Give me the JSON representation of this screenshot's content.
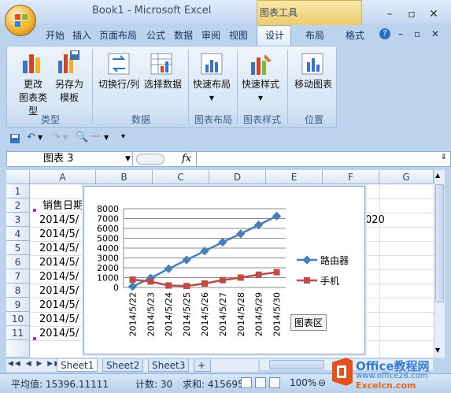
{
  "window": {
    "title": "Book1 - Microsoft Excel",
    "context_tab": "图表工具"
  },
  "tabs": [
    "开始",
    "插入",
    "页面布局",
    "公式",
    "数据",
    "审阅",
    "视图",
    "设计",
    "布局",
    "格式"
  ],
  "ribbon": {
    "groups": [
      {
        "label": "类型",
        "buttons": [
          "更改\n图表类型",
          "另存为\n模板"
        ]
      },
      {
        "label": "数据",
        "buttons": [
          "切换行/列",
          "选择数据"
        ]
      },
      {
        "label": "图表布局",
        "buttons": [
          "快速布局"
        ]
      },
      {
        "label": "图表样式",
        "buttons": [
          "快速样式"
        ]
      },
      {
        "label": "位置",
        "buttons": [
          "移动图表"
        ]
      }
    ],
    "b1": "更改",
    "b1b": "图表类型",
    "b2": "另存为",
    "b2b": "模板",
    "b3": "切换行/列",
    "b4": "选择数据",
    "b5": "快速布局",
    "b6": "快速样式",
    "b7": "移动图表",
    "g1": "类型",
    "g2": "数据",
    "g3": "图表布局",
    "g4": "图表样式",
    "g5": "位置"
  },
  "formula_bar": {
    "name_box": "图表 3",
    "fx": "fx"
  },
  "sheet": {
    "columns": [
      "A",
      "B",
      "C",
      "D",
      "E",
      "F",
      "G"
    ],
    "rows": [
      "1",
      "2",
      "3",
      "4",
      "5",
      "6",
      "7",
      "8",
      "9",
      "10",
      "11"
    ],
    "a2": "销售日期",
    "a_values": [
      "2014/5/",
      "2014/5/",
      "2014/5/",
      "2014/5/",
      "2014/5/",
      "2014/5/",
      "2014/5/",
      "2014/5/",
      "2014/5/"
    ],
    "f3": "020"
  },
  "chart_data": {
    "type": "line",
    "categories": [
      "2014/5/22",
      "2014/5/23",
      "2014/5/24",
      "2014/5/25",
      "2014/5/26",
      "2014/5/27",
      "2014/5/28",
      "2014/5/29",
      "2014/5/30"
    ],
    "series": [
      {
        "name": "路由器",
        "values": [
          100,
          950,
          1900,
          2800,
          3700,
          4600,
          5450,
          6350,
          7250
        ],
        "color": "#4a7ebb"
      },
      {
        "name": "手机",
        "values": [
          800,
          600,
          200,
          150,
          400,
          750,
          1000,
          1300,
          1550
        ],
        "color": "#be4b48"
      }
    ],
    "ylim": [
      0,
      8000
    ],
    "yticks": [
      "0",
      "1000",
      "2000",
      "3000",
      "4000",
      "5000",
      "6000",
      "7000",
      "8000"
    ],
    "legend": "right",
    "tooltip": "图表区"
  },
  "sheet_tabs": [
    "Sheet1",
    "Sheet2",
    "Sheet3"
  ],
  "status": {
    "avg": "平均值: 15396.11111",
    "count": "计数: 30",
    "sum": "求和: 415695",
    "zoom": "100%"
  },
  "watermark": {
    "line1": "Office教程网",
    "line2": "www.office26.com",
    "line3": "Excelcn.com"
  }
}
